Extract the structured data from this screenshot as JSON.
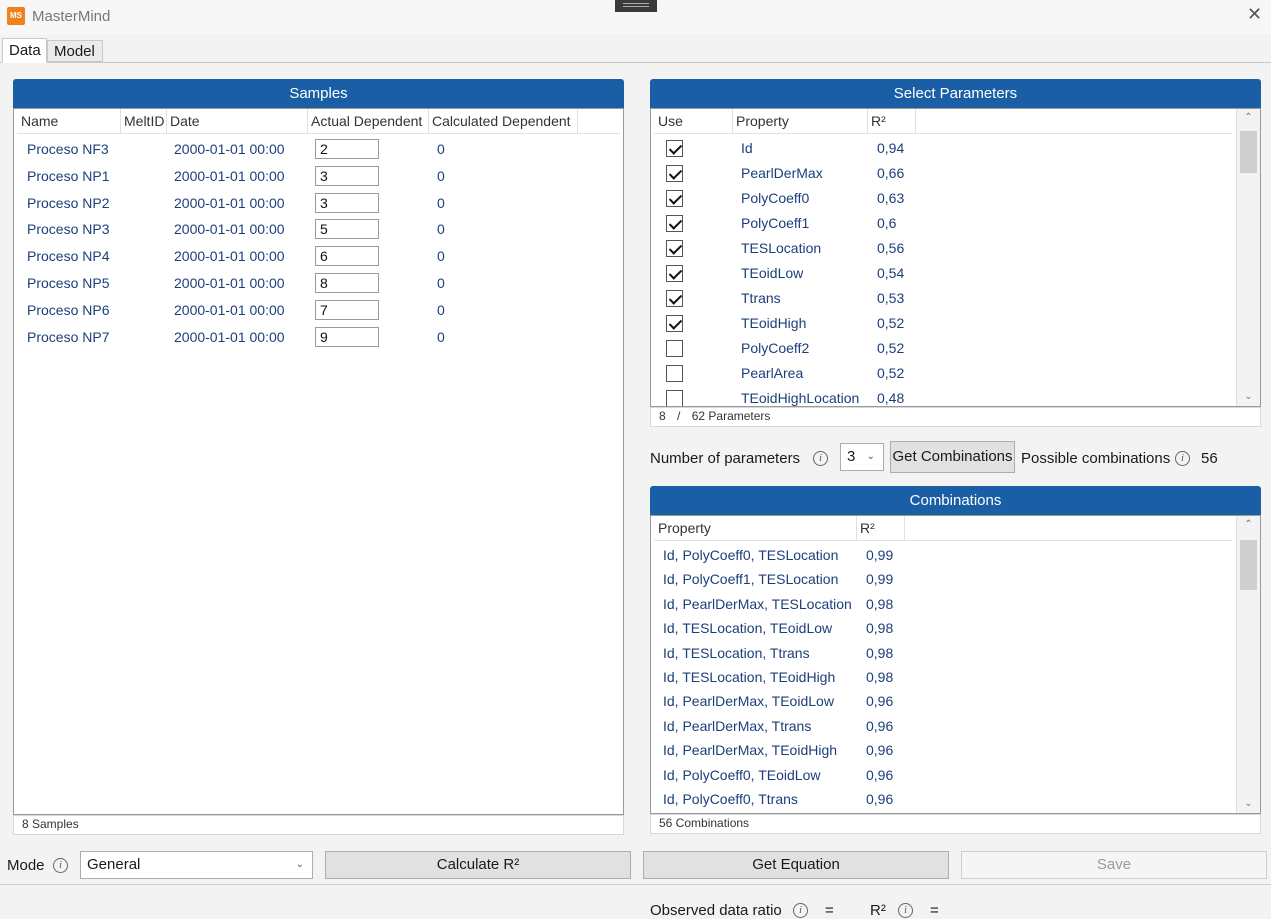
{
  "app": {
    "logo_text": "MS",
    "title": "MasterMind",
    "close_glyph": "✕"
  },
  "tabs": [
    {
      "label": "Data"
    },
    {
      "label": "Model"
    }
  ],
  "samples": {
    "title": "Samples",
    "columns": [
      "Name",
      "MeltID",
      "Date",
      "Actual Dependent",
      "Calculated Dependent"
    ],
    "rows": [
      {
        "name": "Proceso NF3",
        "meltid": "",
        "date": "2000-01-01 00:00",
        "actual": "2",
        "calculated": "0"
      },
      {
        "name": "Proceso NP1",
        "meltid": "",
        "date": "2000-01-01 00:00",
        "actual": "3",
        "calculated": "0"
      },
      {
        "name": "Proceso NP2",
        "meltid": "",
        "date": "2000-01-01 00:00",
        "actual": "3",
        "calculated": "0"
      },
      {
        "name": "Proceso NP3",
        "meltid": "",
        "date": "2000-01-01 00:00",
        "actual": "5",
        "calculated": "0"
      },
      {
        "name": "Proceso NP4",
        "meltid": "",
        "date": "2000-01-01 00:00",
        "actual": "6",
        "calculated": "0"
      },
      {
        "name": "Proceso NP5",
        "meltid": "",
        "date": "2000-01-01 00:00",
        "actual": "8",
        "calculated": "0"
      },
      {
        "name": "Proceso NP6",
        "meltid": "",
        "date": "2000-01-01 00:00",
        "actual": "7",
        "calculated": "0"
      },
      {
        "name": "Proceso NP7",
        "meltid": "",
        "date": "2000-01-01 00:00",
        "actual": "9",
        "calculated": "0"
      }
    ],
    "footer": "8 Samples"
  },
  "parameters": {
    "title": "Select Parameters",
    "columns": [
      "Use",
      "Property",
      "R²"
    ],
    "rows": [
      {
        "checked": true,
        "property": "Id",
        "r2": "0,94"
      },
      {
        "checked": true,
        "property": "PearlDerMax",
        "r2": "0,66"
      },
      {
        "checked": true,
        "property": "PolyCoeff0",
        "r2": "0,63"
      },
      {
        "checked": true,
        "property": "PolyCoeff1",
        "r2": "0,6"
      },
      {
        "checked": true,
        "property": "TESLocation",
        "r2": "0,56"
      },
      {
        "checked": true,
        "property": "TEoidLow",
        "r2": "0,54"
      },
      {
        "checked": true,
        "property": "Ttrans",
        "r2": "0,53"
      },
      {
        "checked": true,
        "property": "TEoidHigh",
        "r2": "0,52"
      },
      {
        "checked": false,
        "property": "PolyCoeff2",
        "r2": "0,52"
      },
      {
        "checked": false,
        "property": "PearlArea",
        "r2": "0,52"
      },
      {
        "checked": false,
        "property": "TEoidHighLocation",
        "r2": "0,48"
      }
    ],
    "footer": {
      "selected": "8",
      "separator": "/",
      "total": "62 Parameters"
    }
  },
  "controls": {
    "num_params_label": "Number of parameters",
    "num_params_value": "3",
    "get_combinations_label": "Get Combinations",
    "possible_label": "Possible combinations",
    "possible_value": "56",
    "info_glyph": "i"
  },
  "combinations": {
    "title": "Combinations",
    "columns": [
      "Property",
      "R²"
    ],
    "rows": [
      {
        "property": "Id, PolyCoeff0, TESLocation",
        "r2": "0,99"
      },
      {
        "property": "Id, PolyCoeff1, TESLocation",
        "r2": "0,99"
      },
      {
        "property": "Id, PearlDerMax, TESLocation",
        "r2": "0,98"
      },
      {
        "property": "Id, TESLocation, TEoidLow",
        "r2": "0,98"
      },
      {
        "property": "Id, TESLocation, Ttrans",
        "r2": "0,98"
      },
      {
        "property": "Id, TESLocation, TEoidHigh",
        "r2": "0,98"
      },
      {
        "property": "Id, PearlDerMax, TEoidLow",
        "r2": "0,96"
      },
      {
        "property": "Id, PearlDerMax, Ttrans",
        "r2": "0,96"
      },
      {
        "property": "Id, PearlDerMax, TEoidHigh",
        "r2": "0,96"
      },
      {
        "property": "Id, PolyCoeff0, TEoidLow",
        "r2": "0,96"
      },
      {
        "property": "Id, PolyCoeff0, Ttrans",
        "r2": "0,96"
      }
    ],
    "footer": "56 Combinations"
  },
  "bottom": {
    "mode_label": "Mode",
    "mode_value": "General",
    "calculate_label": "Calculate R²",
    "equation_label": "Get Equation",
    "save_label": "Save",
    "observed_label": "Observed data ratio",
    "r2_label": "R²",
    "equals": "="
  },
  "colors": {
    "accent": "#1a5fa6",
    "logo": "#f0821e",
    "link_text": "#1c3f7a"
  },
  "icons": {
    "info": "info-icon",
    "caret": "chevron-down-icon",
    "close": "close-icon"
  }
}
